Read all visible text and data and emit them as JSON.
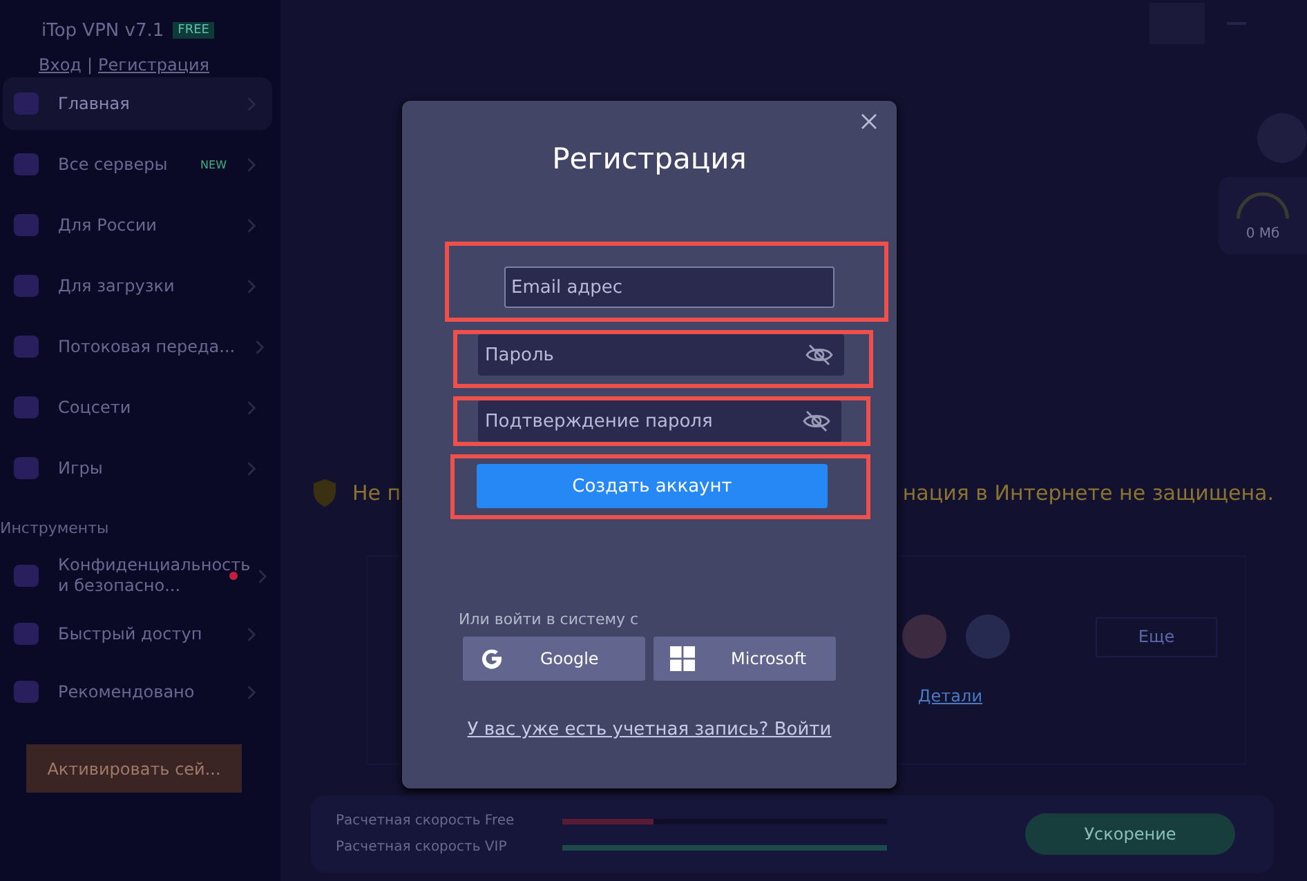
{
  "app": {
    "title": "iTop VPN v7.1",
    "badge": "FREE",
    "login": "Вход",
    "separator": "|",
    "register": "Регистрация"
  },
  "sidebar": {
    "items": [
      {
        "label": "Главная",
        "selected": true
      },
      {
        "label": "Все серверы",
        "selected": false,
        "badge": "NEW"
      },
      {
        "label": "Для России",
        "selected": false
      },
      {
        "label": "Для загрузки",
        "selected": false
      },
      {
        "label": "Потоковая переда...",
        "selected": false
      },
      {
        "label": "Соцсети",
        "selected": false
      },
      {
        "label": "Игры",
        "selected": false
      }
    ],
    "tools_heading": "Инструменты",
    "tools": [
      {
        "label": "Конфиденциальность и безопасно...",
        "dot": true
      },
      {
        "label": "Быстрый доступ",
        "dot": false
      },
      {
        "label": "Рекомендовано",
        "dot": false
      }
    ],
    "activate_button": "Активировать сей..."
  },
  "main": {
    "ping": "0 Мб",
    "warning_left": "Не п",
    "warning_right": "нация в Интернете не защищена.",
    "more_dropdown": "Еще",
    "details_link": "Детали",
    "speeds": [
      {
        "label": "Расчетная скорость Free",
        "level": 0.28,
        "color": "#5a1b33"
      },
      {
        "label": "Расчетная скорость VIP",
        "level": 1,
        "color": "#1d4a4a"
      }
    ],
    "boost_button": "Ускорение"
  },
  "dialog": {
    "title": "Регистрация",
    "fields": [
      {
        "placeholder": "Email адрес",
        "kind": "email",
        "focused": true,
        "highlighted": true
      },
      {
        "placeholder": "Пароль",
        "kind": "password",
        "focused": false,
        "highlighted": true
      },
      {
        "placeholder": "Подтверждение пароля",
        "kind": "password",
        "focused": false,
        "highlighted": true
      }
    ],
    "submit": {
      "label": "Создать аккаунт",
      "highlighted": true
    },
    "alt_label": "Или войти в систему с",
    "providers": [
      {
        "label": "Google",
        "kind": "google"
      },
      {
        "label": "Microsoft",
        "kind": "microsoft"
      }
    ],
    "signin_link": "У вас уже есть учетная запись? Войти"
  }
}
